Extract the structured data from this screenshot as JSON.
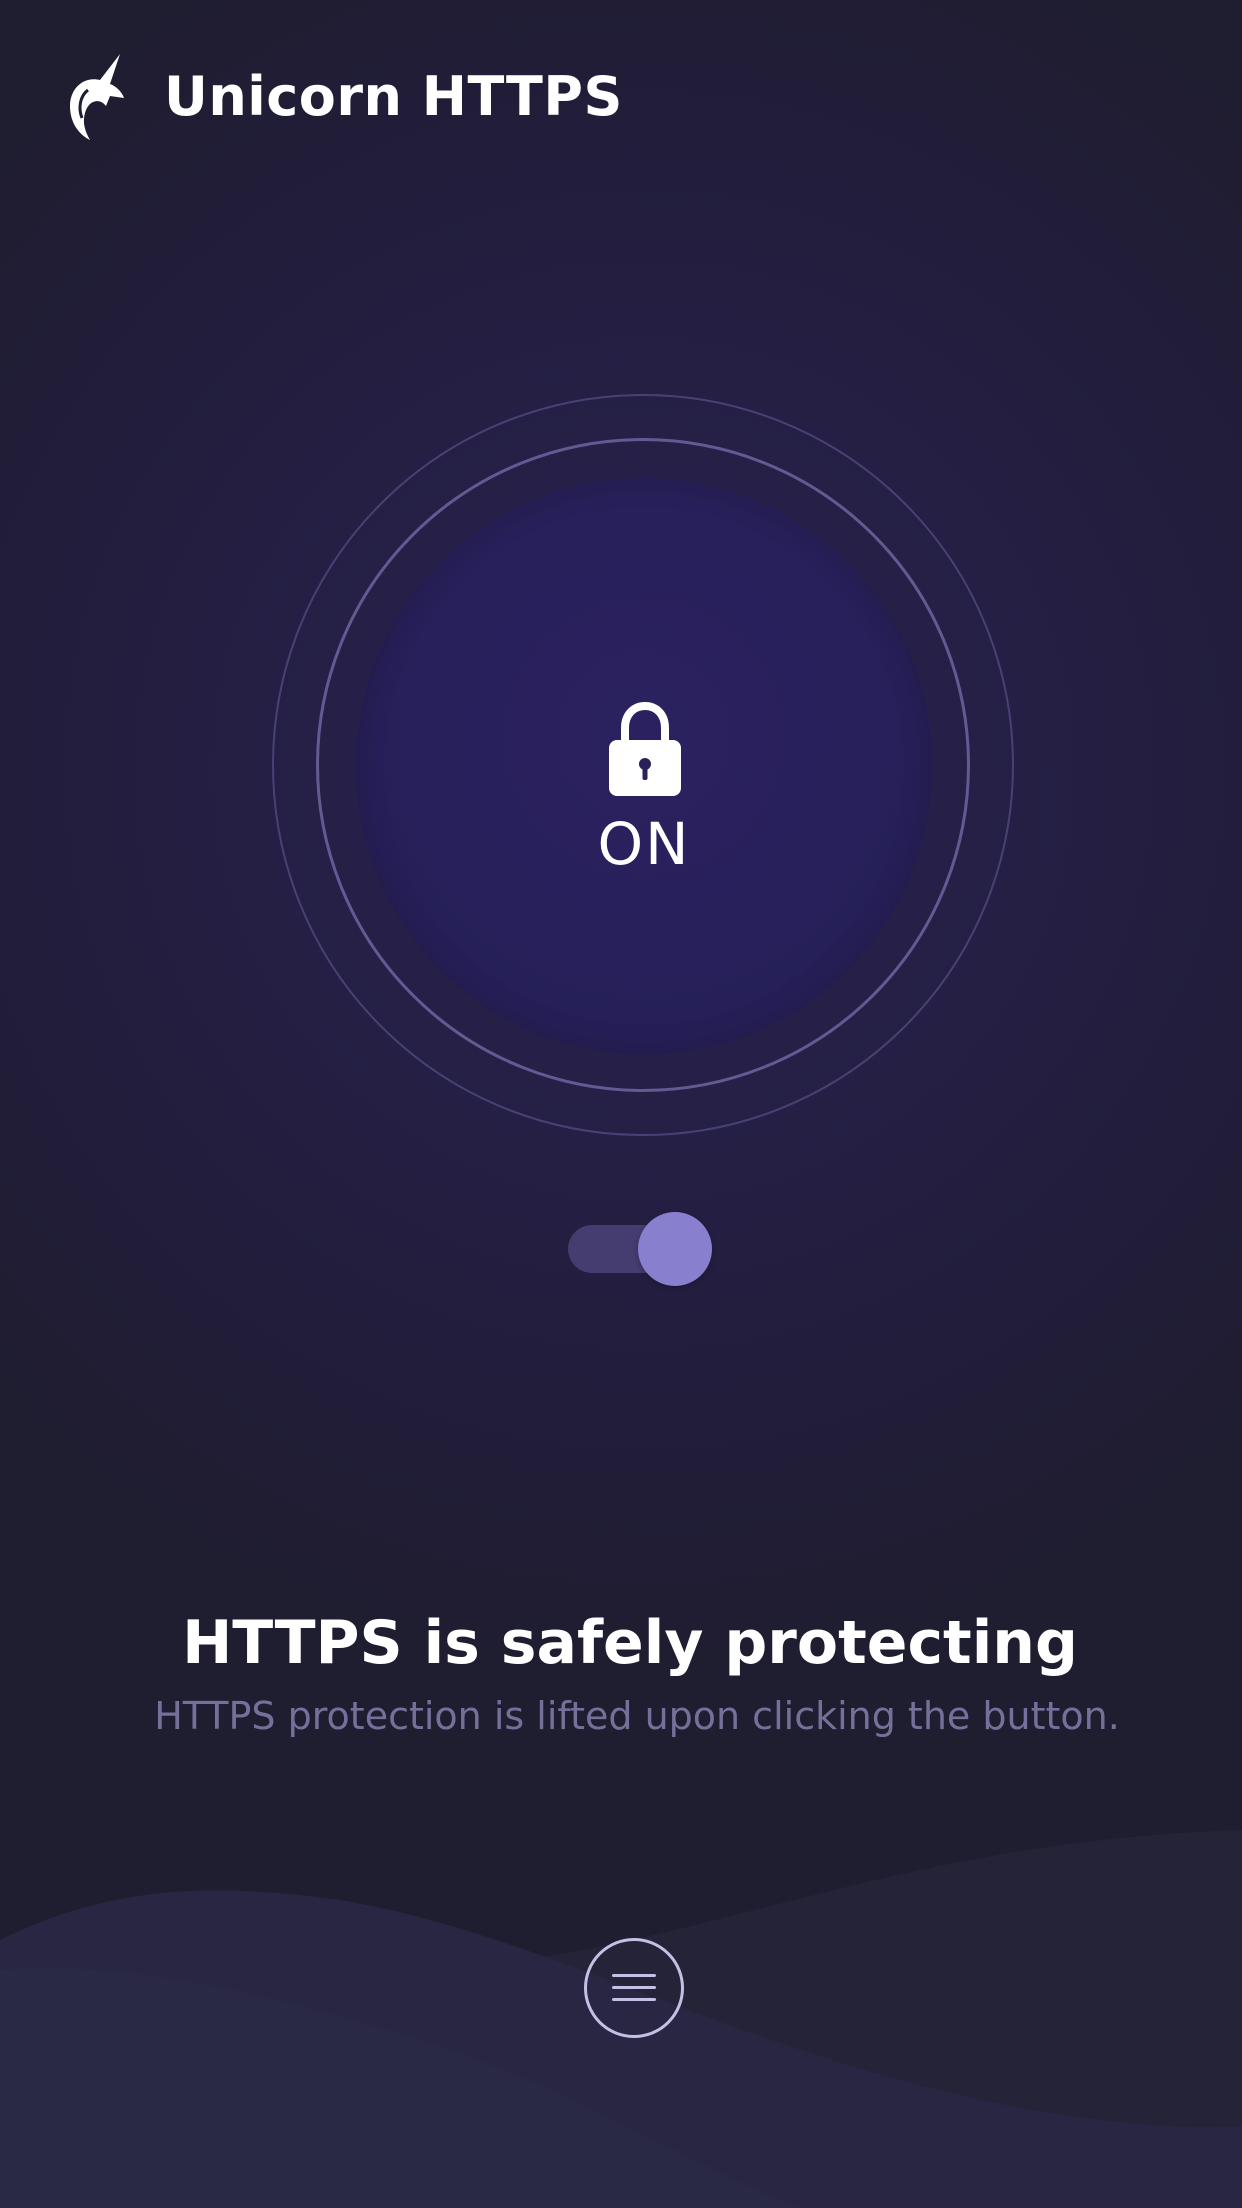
{
  "header": {
    "app_title": "Unicorn HTTPS",
    "logo_icon": "unicorn-logo-icon"
  },
  "protection_button": {
    "icon": "lock-icon",
    "state_label": "ON"
  },
  "toggle": {
    "state": "on",
    "icon": "toggle-switch"
  },
  "status": {
    "title": "HTTPS is safely protecting",
    "subtitle": "HTTPS protection is lifted upon clicking the button."
  },
  "footer": {
    "menu_icon": "hamburger-menu-icon"
  },
  "colors": {
    "background": "#1f1d30",
    "accent": "#8880cf",
    "track": "#453c70",
    "subtitle": "#75709a"
  }
}
